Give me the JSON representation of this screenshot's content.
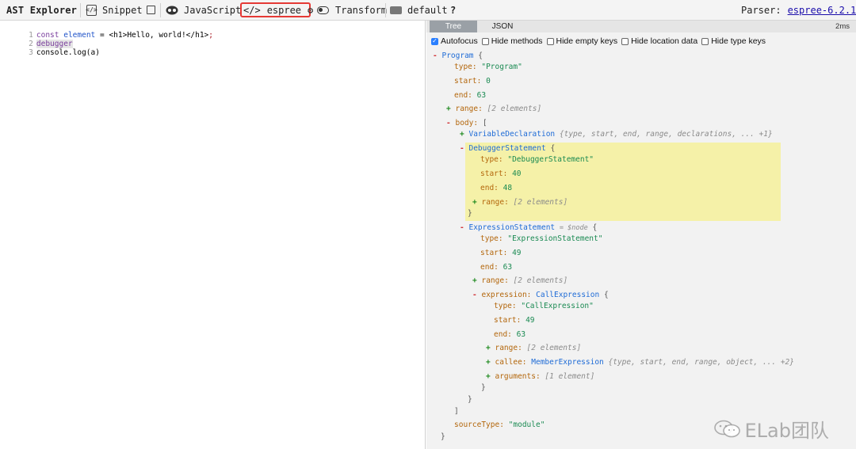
{
  "toolbar": {
    "app_title": "AST Explorer",
    "snippet_label": "Snippet",
    "language_label": "JavaScript",
    "parser_label": "espree",
    "transform_label": "Transform",
    "default_label": "default",
    "help_label": "?",
    "parser_info_label": "Parser:",
    "parser_version": "espree-6.2.1"
  },
  "editor": {
    "lines": [
      {
        "number": "1",
        "text": "const element = <h1>Hello, world!</h1>;"
      },
      {
        "number": "2",
        "text": "debugger"
      },
      {
        "number": "3",
        "text": "console.log(a)"
      }
    ]
  },
  "panel": {
    "tabs": [
      "Tree",
      "JSON"
    ],
    "active_tab": "Tree",
    "time": "2ms",
    "options": [
      {
        "label": "Autofocus",
        "checked": true
      },
      {
        "label": "Hide methods",
        "checked": false
      },
      {
        "label": "Hide empty keys",
        "checked": false
      },
      {
        "label": "Hide location data",
        "checked": false
      },
      {
        "label": "Hide type keys",
        "checked": false
      }
    ]
  },
  "tree": {
    "program": "Program",
    "program_type": "\"Program\"",
    "program_start": "0",
    "program_end": "63",
    "range_summary": "[2 elements]",
    "var_decl": "VariableDeclaration",
    "var_decl_summary": "{type, start, end, range, declarations, ... +1}",
    "debugger_stmt": "DebuggerStatement",
    "debugger_type": "\"DebuggerStatement\"",
    "debugger_start": "40",
    "debugger_end": "48",
    "expr_stmt": "ExpressionStatement",
    "expr_node_alias": "= $node",
    "expr_type": "\"ExpressionStatement\"",
    "expr_start": "49",
    "expr_end": "63",
    "call_expr": "CallExpression",
    "call_type": "\"CallExpression\"",
    "call_start": "49",
    "call_end": "63",
    "member_expr": "MemberExpression",
    "member_summary": "{type, start, end, range, object, ... +2}",
    "arguments_summary": "[1 element]",
    "source_type": "\"module\"",
    "keys": {
      "type": "type:",
      "start": "start:",
      "end": "end:",
      "range": "range:",
      "body": "body:",
      "expression": "expression:",
      "callee": "callee:",
      "arguments": "arguments:",
      "sourceType": "sourceType:"
    }
  },
  "watermark": {
    "text": "ELab团队"
  }
}
